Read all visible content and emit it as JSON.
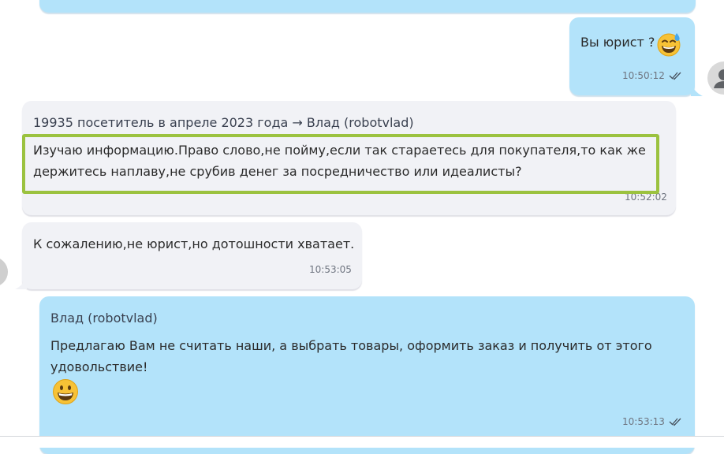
{
  "chat": {
    "messages": [
      {
        "direction": "outgoing",
        "text": "Вы юрист ?",
        "emoji": "sweat-smile-emoji",
        "time": "10:50:12",
        "status": "read"
      },
      {
        "direction": "incoming",
        "sender": "19935 посетитель в апреле 2023 года → Влад (robotvlad)",
        "lines": [
          "Изучаю информацию.Право слово,не пойму,если так стараетесь для покупателя,то как же",
          "держитесь наплаву,не срубив денег за посредничество или идеалисты?"
        ],
        "time": "10:52:02"
      },
      {
        "direction": "incoming",
        "text": "К сожалению,не юрист,но дотошности хватает.",
        "time": "10:53:05"
      },
      {
        "direction": "outgoing",
        "sender": "Влад (robotvlad)",
        "lines": [
          "Предлагаю Вам не считать наши, а выбрать товары, оформить заказ и получить от этого",
          "удовольствие!"
        ],
        "emoji": "grinning-emoji",
        "time": "10:53:13",
        "status": "read"
      }
    ]
  },
  "colors": {
    "outgoing_bubble": "#b3e3fa",
    "incoming_bubble": "#f1f2f6",
    "highlight_border": "#9bc23f",
    "avatar_bg": "#d9d9d9",
    "read_check": "#46505c"
  }
}
